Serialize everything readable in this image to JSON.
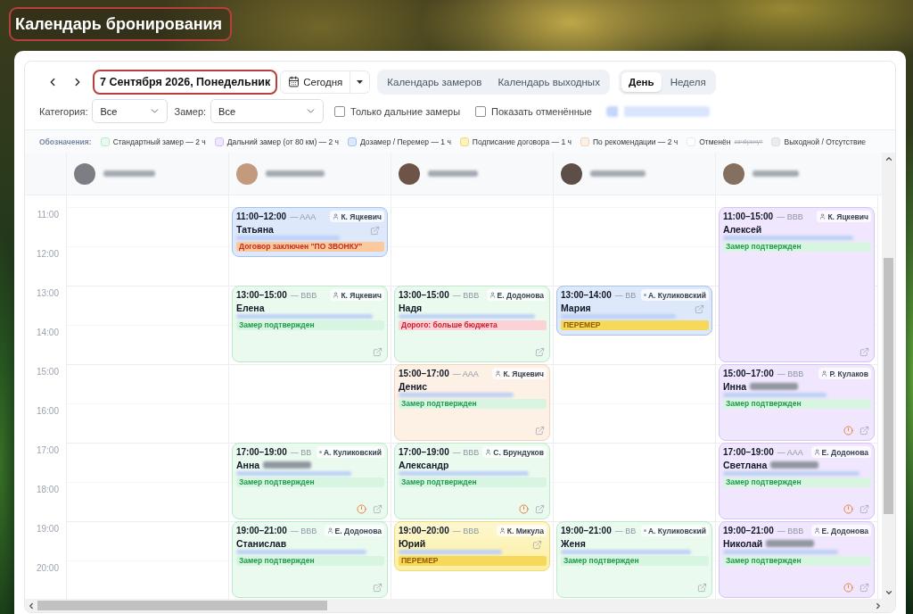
{
  "page_title": "Календарь бронирования",
  "toolbar": {
    "date": "7 Сентября 2026, Понедельник",
    "today_button": "Сегодня",
    "calendar_tabs": [
      {
        "label": "Календарь замеров"
      },
      {
        "label": "Календарь выходных"
      }
    ],
    "view_tabs": [
      {
        "label": "День",
        "selected": true
      },
      {
        "label": "Неделя",
        "selected": false
      }
    ]
  },
  "filters": {
    "selects": [
      {
        "label": "Категория:",
        "value": "Все"
      },
      {
        "label": "Замер:",
        "value": "Все"
      }
    ],
    "checkboxes": [
      {
        "label": "Только дальние замеры",
        "checked": false
      },
      {
        "label": "Показать отменённые",
        "checked": false
      }
    ]
  },
  "legend": {
    "title": "Обозначения:",
    "items": [
      {
        "kind": "standard",
        "label": "Стандартный замер — 2 ч"
      },
      {
        "kind": "long",
        "label": "Дальний замер (от 80 км) — 2 ч"
      },
      {
        "kind": "remeasure",
        "label": "Дозамер / Перемер — 1 ч"
      },
      {
        "kind": "contract",
        "label": "Подписание договора — 1 ч"
      },
      {
        "kind": "referral",
        "label": "По рекомендации — 2 ч"
      },
      {
        "kind": "cancelled",
        "label": "Отменён",
        "note": "зачёркнут"
      },
      {
        "kind": "day_off",
        "label": "Выходной / Отсутствие"
      }
    ]
  },
  "schedule": {
    "hours": [
      "11:00",
      "12:00",
      "13:00",
      "14:00",
      "15:00",
      "16:00",
      "17:00",
      "18:00",
      "19:00",
      "20:00"
    ],
    "columns": [
      {},
      {
        "events": [
          {
            "kind": "remeasure",
            "time": "11:00–12:00",
            "code": "— AAA",
            "assignee": {
              "kind": "person",
              "name": "К. Яцкевич"
            },
            "client": "Татьяна",
            "surname_blurred": false,
            "alert": false,
            "tags": [
              {
                "kind": "contract",
                "text": "Договор заключен \"ПО ЗВОНКУ\""
              }
            ]
          },
          {
            "kind": "standard",
            "time": "13:00–15:00",
            "code": "— BBB",
            "assignee": {
              "kind": "person",
              "name": "К. Яцкевич"
            },
            "client": "Елена",
            "surname_blurred": false,
            "alert": false,
            "tags": [
              {
                "kind": "status",
                "text": "Замер подтвержден"
              }
            ]
          },
          {
            "kind": "standard",
            "time": "17:00–19:00",
            "code": "— BB",
            "assignee": {
              "kind": "dot",
              "name": "А. Куликовский"
            },
            "client": "Анна",
            "surname_blurred": true,
            "alert": true,
            "tags": [
              {
                "kind": "status",
                "text": "Замер подтвержден"
              }
            ]
          },
          {
            "kind": "standard",
            "time": "19:00–21:00",
            "code": "— BBB",
            "assignee": {
              "kind": "person",
              "name": "Е. Додонова"
            },
            "client": "Станислав",
            "surname_blurred": false,
            "alert": false,
            "tags": [
              {
                "kind": "status",
                "text": "Замер подтвержден"
              }
            ]
          }
        ]
      },
      {
        "events": [
          {
            "kind": "standard",
            "time": "13:00–15:00",
            "code": "— BBB",
            "assignee": {
              "kind": "person",
              "name": "Е. Додонова"
            },
            "client": "Надя",
            "surname_blurred": false,
            "alert": false,
            "tags": [
              {
                "kind": "warning",
                "text": "Дорого: больше бюджета"
              }
            ]
          },
          {
            "kind": "referral",
            "time": "15:00–17:00",
            "code": "— AAA",
            "assignee": {
              "kind": "person",
              "name": "К. Яцкевич"
            },
            "client": "Денис",
            "surname_blurred": false,
            "alert": false,
            "tags": [
              {
                "kind": "status",
                "text": "Замер подтвержден"
              }
            ]
          },
          {
            "kind": "standard",
            "time": "17:00–19:00",
            "code": "— BBB",
            "assignee": {
              "kind": "person",
              "name": "С. Брундуков"
            },
            "client": "Александр",
            "surname_blurred": false,
            "alert": true,
            "tags": [
              {
                "kind": "status",
                "text": "Замер подтвержден"
              }
            ]
          },
          {
            "kind": "contract",
            "time": "19:00–20:00",
            "code": "— BBB",
            "assignee": {
              "kind": "person",
              "name": "К. Микула"
            },
            "client": "Юрий",
            "surname_blurred": false,
            "alert": false,
            "tags": [
              {
                "kind": "remeasure",
                "text": "ПЕРЕМЕР"
              }
            ]
          }
        ]
      },
      {
        "events": [
          {
            "kind": "remeasure",
            "time": "13:00–14:00",
            "code": "— BB",
            "assignee": {
              "kind": "dot",
              "name": "А. Куликовский"
            },
            "client": "Мария",
            "surname_blurred": false,
            "alert": false,
            "tags": [
              {
                "kind": "remeasure",
                "text": "ПЕРЕМЕР"
              }
            ]
          },
          {
            "kind": "standard",
            "time": "19:00–21:00",
            "code": "— BB",
            "assignee": {
              "kind": "dot",
              "name": "А. Куликовский"
            },
            "client": "Женя",
            "surname_blurred": false,
            "alert": false,
            "tags": [
              {
                "kind": "status",
                "text": "Замер подтвержден"
              }
            ]
          }
        ]
      },
      {
        "events": [
          {
            "kind": "long",
            "time": "11:00–15:00",
            "code": "— BBB",
            "assignee": {
              "kind": "person",
              "name": "К. Яцкевич"
            },
            "client": "Алексей",
            "surname_blurred": false,
            "alert": false,
            "tags": [
              {
                "kind": "status",
                "text": "Замер подтвержден"
              }
            ]
          },
          {
            "kind": "long",
            "time": "15:00–17:00",
            "code": "— BBB",
            "assignee": {
              "kind": "person",
              "name": "Р. Кулаков"
            },
            "client": "Инна",
            "surname_blurred": true,
            "alert": true,
            "tags": [
              {
                "kind": "status",
                "text": "Замер подтвержден"
              }
            ]
          },
          {
            "kind": "long",
            "time": "17:00–19:00",
            "code": "— AAA",
            "assignee": {
              "kind": "person",
              "name": "Е. Додонова"
            },
            "client": "Светлана",
            "surname_blurred": true,
            "alert": true,
            "tags": [
              {
                "kind": "status",
                "text": "Замер подтвержден"
              }
            ]
          },
          {
            "kind": "long",
            "time": "19:00–21:00",
            "code": "— BBB",
            "assignee": {
              "kind": "person",
              "name": "Е. Додонова"
            },
            "client": "Николай",
            "surname_blurred": true,
            "alert": true,
            "tags": [
              {
                "kind": "status",
                "text": "Замер подтвержден"
              }
            ]
          }
        ]
      }
    ]
  }
}
